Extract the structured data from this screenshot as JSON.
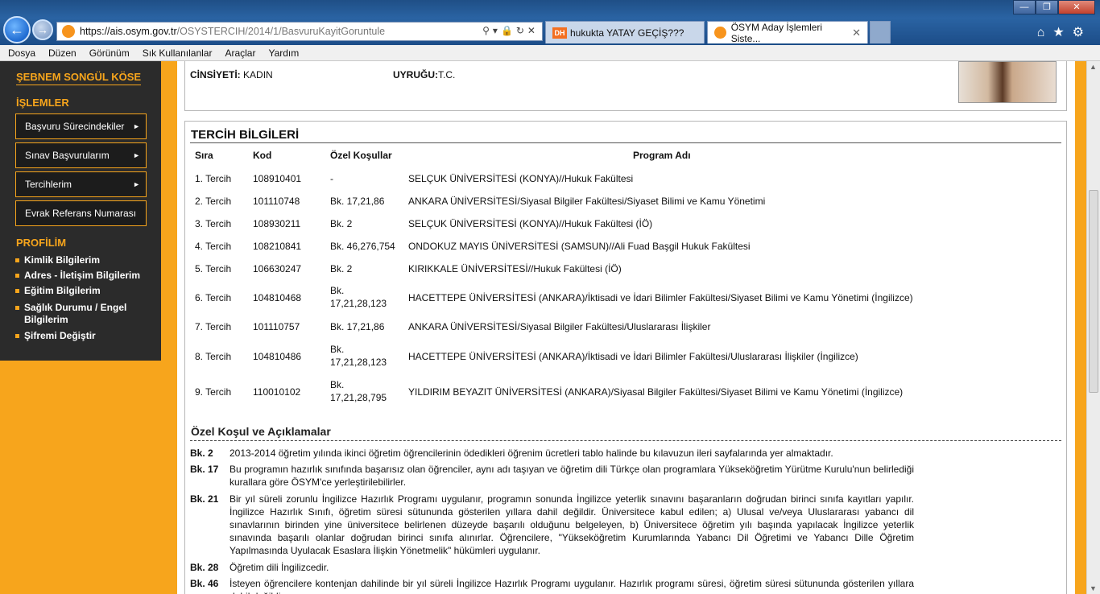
{
  "browser": {
    "url_host": "https://ais.osym.gov.tr",
    "url_path": "/OSYSTERCIH/2014/1/BasvuruKayitGoruntule",
    "tabs": [
      {
        "label": "hukukta YATAY GEÇİŞ???",
        "icon_text": "DH"
      },
      {
        "label": "ÖSYM Aday İşlemleri Siste..."
      }
    ],
    "menu": [
      "Dosya",
      "Düzen",
      "Görünüm",
      "Sık Kullanılanlar",
      "Araçlar",
      "Yardım"
    ]
  },
  "sidebar": {
    "user_name": "ŞEBNEM SONGÜL KÖSE",
    "islemler_heading": "İŞLEMLER",
    "buttons": [
      "Başvuru Sürecindekiler",
      "Sınav Başvurularım",
      "Tercihlerim",
      "Evrak Referans Numarası"
    ],
    "profilim_heading": "PROFİLİM",
    "profile_links": [
      {
        "line1": "Kimlik Bilgilerim"
      },
      {
        "line1": "Adres - İletişim Bilgilerim"
      },
      {
        "line1": "Eğitim Bilgilerim"
      },
      {
        "line1": "Sağlık Durumu / Engel",
        "line2": "Bilgilerim"
      },
      {
        "line1": "Şifremi Değiştir"
      }
    ]
  },
  "personal": {
    "cinsiyet_label": "CİNSİYETİ:",
    "cinsiyet_value": "KADIN",
    "uyruk_label": "UYRUĞU:",
    "uyruk_value": "T.C."
  },
  "tercih": {
    "title": "TERCİH BİLGİLERİ",
    "headers": {
      "sira": "Sıra",
      "kod": "Kod",
      "kosul": "Özel Koşullar",
      "program": "Program Adı"
    },
    "rows": [
      {
        "sira": "1. Tercih",
        "kod": "108910401",
        "kosul": "-",
        "kosul2": "",
        "program": "SELÇUK ÜNİVERSİTESİ (KONYA)//Hukuk Fakültesi"
      },
      {
        "sira": "2. Tercih",
        "kod": "101110748",
        "kosul": "Bk. 17,21,86",
        "kosul2": "",
        "program": "ANKARA ÜNİVERSİTESİ/Siyasal Bilgiler Fakültesi/Siyaset Bilimi ve Kamu Yönetimi"
      },
      {
        "sira": "3. Tercih",
        "kod": "108930211",
        "kosul": "Bk. 2",
        "kosul2": "",
        "program": "SELÇUK ÜNİVERSİTESİ (KONYA)//Hukuk Fakültesi (İÖ)"
      },
      {
        "sira": "4. Tercih",
        "kod": "108210841",
        "kosul": "Bk. 46,276,754",
        "kosul2": "",
        "program": "ONDOKUZ MAYIS ÜNİVERSİTESİ (SAMSUN)//Ali Fuad Başgil Hukuk Fakültesi"
      },
      {
        "sira": "5. Tercih",
        "kod": "106630247",
        "kosul": "Bk. 2",
        "kosul2": "",
        "program": "KIRIKKALE ÜNİVERSİTESİ//Hukuk Fakültesi (İÖ)"
      },
      {
        "sira": "6. Tercih",
        "kod": "104810468",
        "kosul": "Bk.",
        "kosul2": "17,21,28,123",
        "program": "HACETTEPE ÜNİVERSİTESİ (ANKARA)/İktisadi ve İdari Bilimler Fakültesi/Siyaset Bilimi ve Kamu Yönetimi (İngilizce)"
      },
      {
        "sira": "7. Tercih",
        "kod": "101110757",
        "kosul": "Bk. 17,21,86",
        "kosul2": "",
        "program": "ANKARA ÜNİVERSİTESİ/Siyasal Bilgiler Fakültesi/Uluslararası İlişkiler"
      },
      {
        "sira": "8. Tercih",
        "kod": "104810486",
        "kosul": "Bk.",
        "kosul2": "17,21,28,123",
        "program": "HACETTEPE ÜNİVERSİTESİ (ANKARA)/İktisadi ve İdari Bilimler Fakültesi/Uluslararası İlişkiler (İngilizce)"
      },
      {
        "sira": "9. Tercih",
        "kod": "110010102",
        "kosul": "Bk.",
        "kosul2": "17,21,28,795",
        "program": "YILDIRIM BEYAZIT ÜNİVERSİTESİ (ANKARA)/Siyasal Bilgiler Fakültesi/Siyaset Bilimi ve Kamu Yönetimi (İngilizce)"
      }
    ]
  },
  "kosullar": {
    "title": "Özel Koşul ve Açıklamalar",
    "notes": [
      {
        "code": "Bk. 2",
        "text": "2013-2014 öğretim yılında ikinci öğretim öğrencilerinin ödedikleri öğrenim ücretleri tablo halinde bu kılavuzun ileri sayfalarında yer almaktadır."
      },
      {
        "code": "Bk. 17",
        "text": "Bu programın hazırlık sınıfında başarısız olan öğrenciler, aynı adı taşıyan ve öğretim dili Türkçe olan programlara Yükseköğretim Yürütme Kurulu'nun belirlediği kurallara göre ÖSYM'ce yerleştirilebilirler."
      },
      {
        "code": "Bk. 21",
        "text": "Bir yıl süreli zorunlu İngilizce Hazırlık Programı uygulanır, programın sonunda İngilizce yeterlik sınavını başaranların doğrudan birinci sınıfa kayıtları yapılır. İngilizce Hazırlık Sınıfı, öğretim süresi sütununda gösterilen yıllara dahil değildir. Üniversitece kabul edilen; a) Ulusal ve/veya Uluslararası yabancı dil sınavlarının birinden yine üniversitece belirlenen düzeyde başarılı olduğunu belgeleyen, b) Üniversitece öğretim yılı başında yapılacak İngilizce yeterlik sınavında başarılı olanlar doğrudan birinci sınıfa alınırlar. Öğrencilere, \"Yükseköğretim Kurumlarında Yabancı Dil Öğretimi ve Yabancı Dille Öğretim Yapılmasında Uyulacak Esaslara İlişkin Yönetmelik\" hükümleri uygulanır."
      },
      {
        "code": "Bk. 28",
        "text": "Öğretim dili İngilizcedir."
      },
      {
        "code": "Bk. 46",
        "text": "İsteyen öğrencilere kontenjan dahilinde bir yıl süreli İngilizce Hazırlık Programı uygulanır. Hazırlık programı süresi, öğretim süresi sütununda gösterilen yıllara dahil değildir."
      }
    ]
  }
}
